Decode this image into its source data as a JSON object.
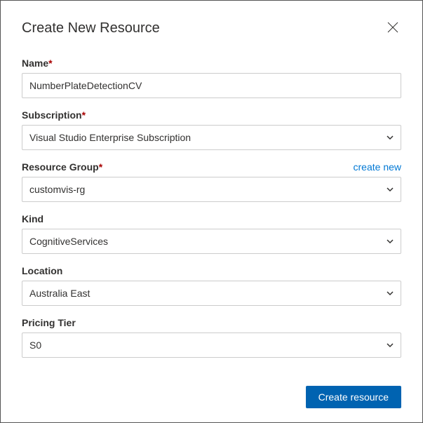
{
  "dialog": {
    "title": "Create New Resource"
  },
  "fields": {
    "name": {
      "label": "Name",
      "value": "NumberPlateDetectionCV"
    },
    "subscription": {
      "label": "Subscription",
      "value": "Visual Studio Enterprise Subscription"
    },
    "resourceGroup": {
      "label": "Resource Group",
      "createNewLabel": "create new",
      "value": "customvis-rg"
    },
    "kind": {
      "label": "Kind",
      "value": "CognitiveServices"
    },
    "location": {
      "label": "Location",
      "value": "Australia East"
    },
    "pricingTier": {
      "label": "Pricing Tier",
      "value": "S0"
    }
  },
  "buttons": {
    "create": "Create resource"
  },
  "requiredMark": "*"
}
